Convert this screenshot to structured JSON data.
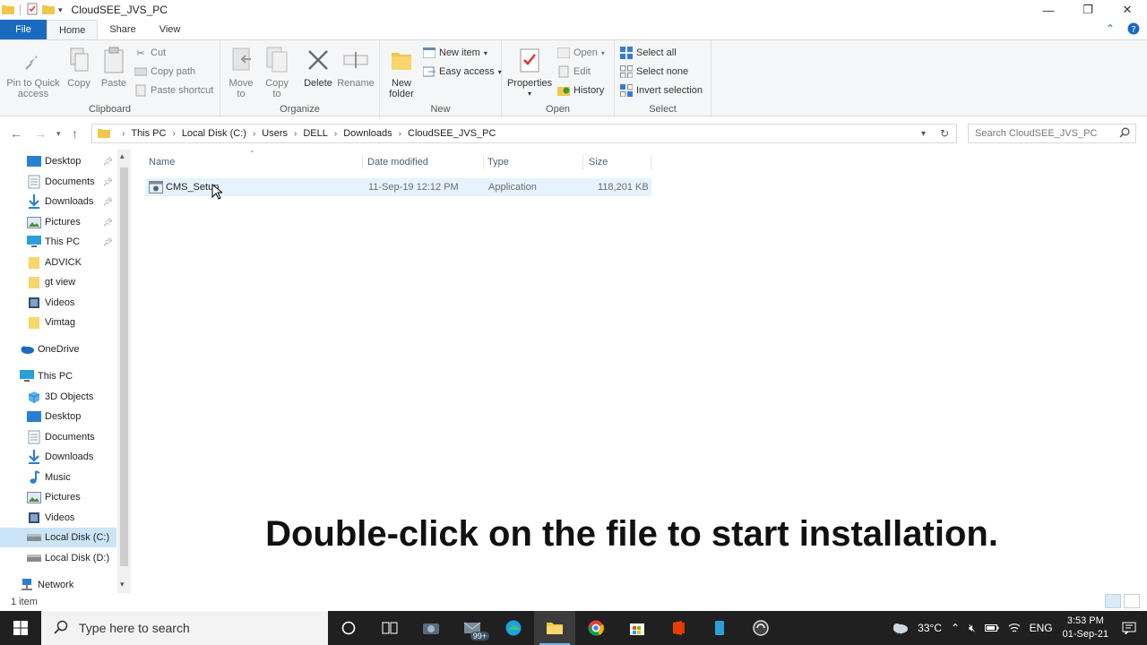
{
  "window": {
    "title": "CloudSEE_JVS_PC",
    "minimize": "—",
    "restore": "❐",
    "close": "✕"
  },
  "tabs": [
    {
      "label": "File"
    },
    {
      "label": "Home"
    },
    {
      "label": "Share"
    },
    {
      "label": "View"
    }
  ],
  "ribbon": {
    "clipboard": {
      "label": "Clipboard",
      "pin": "Pin to Quick access",
      "copy": "Copy",
      "paste": "Paste",
      "cut": "Cut",
      "copy_path": "Copy path",
      "paste_shortcut": "Paste shortcut"
    },
    "organize": {
      "label": "Organize",
      "move_to": "Move to",
      "copy_to": "Copy to",
      "delete": "Delete",
      "rename": "Rename"
    },
    "new": {
      "label": "New",
      "new_folder": "New folder",
      "new_item": "New item",
      "easy_access": "Easy access"
    },
    "open": {
      "label": "Open",
      "properties": "Properties",
      "open": "Open",
      "edit": "Edit",
      "history": "History"
    },
    "select": {
      "label": "Select",
      "select_all": "Select all",
      "select_none": "Select none",
      "invert": "Invert selection"
    }
  },
  "address": {
    "crumbs": [
      "This PC",
      "Local Disk (C:)",
      "Users",
      "DELL",
      "Downloads",
      "CloudSEE_JVS_PC"
    ],
    "search_placeholder": "Search CloudSEE_JVS_PC"
  },
  "nav": {
    "quick": [
      "Desktop",
      "Documents",
      "Downloads",
      "Pictures",
      "This PC",
      "ADVICK",
      "gt view",
      "Videos",
      "Vimtag"
    ],
    "onedrive": "OneDrive",
    "thispc": "This PC",
    "pc_items": [
      "3D Objects",
      "Desktop",
      "Documents",
      "Downloads",
      "Music",
      "Pictures",
      "Videos",
      "Local Disk (C:)",
      "Local Disk (D:)"
    ],
    "network": "Network"
  },
  "columns": {
    "name": "Name",
    "date": "Date modified",
    "type": "Type",
    "size": "Size"
  },
  "files": [
    {
      "name": "CMS_Setup",
      "date": "11-Sep-19 12:12 PM",
      "type": "Application",
      "size": "118,201 KB"
    }
  ],
  "caption": "Double-click on the file to start installation.",
  "status": {
    "count": "1 item"
  },
  "taskbar": {
    "search_placeholder": "Type here to search",
    "badge": "99+",
    "temperature": "33°C",
    "language": "ENG",
    "time": "3:53 PM",
    "date": "01-Sep-21"
  }
}
